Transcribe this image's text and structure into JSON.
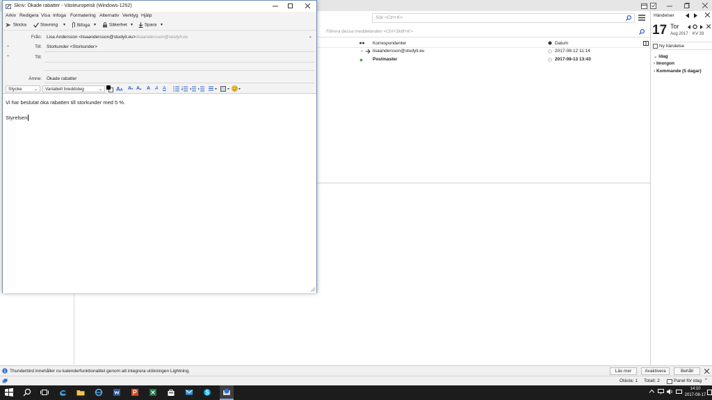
{
  "main": {
    "search_placeholder": "Sök <Ctrl+K>",
    "filter_placeholder": "Filtrera dessa meddelanden <Ctrl+Skift+K>",
    "list_header": {
      "correspondents": "Korrespondenter",
      "date": "Datum"
    },
    "messages": [
      {
        "correspondent": "lisaandersson@studyit.eu",
        "date": "2017-08-12 11:14",
        "bold": false
      },
      {
        "correspondent": "Postmaster",
        "date": "2017-08-13 13:43",
        "bold": true
      }
    ]
  },
  "calendar": {
    "header": "Händelser",
    "day": "17",
    "weekday": "Tor",
    "month_year": "Aug 2017",
    "week": "KV 33",
    "new_event": "Ny händelse",
    "groups": [
      "Idag",
      "Imorgon",
      "Kommande (5 dagar)"
    ]
  },
  "notification": {
    "text": "Thunderbird innehåller nu kalenderfunktionalitet genom att integrera utökningen Lightning.",
    "learn_more": "Läs mer",
    "disable": "Avaktivera",
    "keep": "Behåll"
  },
  "status": {
    "unread": "Olästa: 1",
    "total": "Totalt: 2",
    "today_pane": "Panel för idag"
  },
  "taskbar": {
    "time": "14:10",
    "date": "2017-08-17"
  },
  "compose": {
    "title": "Skriv: Ökade rabatter - Västeuropeisk (Windows-1252)",
    "menu": [
      "Arkiv",
      "Redigera",
      "Visa",
      "Infoga",
      "Formatering",
      "Alternativ",
      "Verktyg",
      "Hjälp"
    ],
    "toolbar": {
      "send": "Skicka",
      "spelling": "Stavning",
      "attach": "Bifoga",
      "security": "Säkerhet",
      "save": "Spara"
    },
    "from_label": "Från:",
    "from_value": "Lisa Andersson <lisaandersson@studyit.eu>",
    "from_hint": "lisaandersson@studyit.eu",
    "to_label": "Till:",
    "to_value": "Storkunder <Storkunder>",
    "to_label2": "Till:",
    "subject_label": "Ämne:",
    "subject_value": "Ökade rabatter",
    "paragraph_style": "Stycke",
    "font": "Variabelt breddsteg",
    "body": [
      "Vi har beslutat öka rabatten till storkunder med 5 %.",
      "Styrelsen"
    ]
  },
  "colors": {
    "accent": "#6a8cb9",
    "postmaster_dot": "#4caf50",
    "taskbar": "#1c1c1c"
  }
}
